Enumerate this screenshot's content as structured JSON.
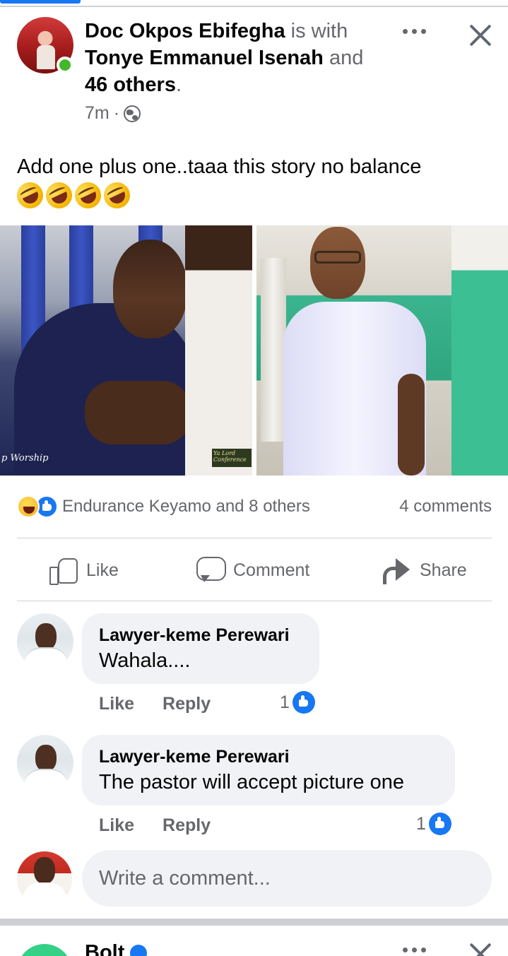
{
  "post": {
    "author": "Doc Okpos Ebifegha",
    "with_text": "is with",
    "tagged": "Tonye Emmanuel Isenah",
    "and_text": "and",
    "others": "46 others",
    "period": ".",
    "time": "7m",
    "separator": "·",
    "text": "Add one plus one..taaa this story no balance",
    "emojis": [
      "rofl-icon",
      "rofl-icon",
      "rofl-icon",
      "rofl-icon"
    ],
    "photo_caption": "p Worship",
    "photo_badge": "Ya Lord Conference"
  },
  "reactions": {
    "summary": "Endurance Keyamo and 8 others",
    "comments_count": "4 comments"
  },
  "actions": {
    "like": "Like",
    "comment": "Comment",
    "share": "Share"
  },
  "comments": [
    {
      "name": "Lawyer-keme Perewari",
      "text": "Wahala....",
      "like_label": "Like",
      "reply_label": "Reply",
      "likes": "1"
    },
    {
      "name": "Lawyer-keme Perewari",
      "text": "The pastor will accept picture one",
      "like_label": "Like",
      "reply_label": "Reply",
      "likes": "1"
    }
  ],
  "composer": {
    "placeholder": "Write a comment..."
  },
  "next_post": {
    "name": "Bolt"
  },
  "colors": {
    "brand_blue": "#1877f2",
    "text_secondary": "#65676b",
    "bubble_bg": "#f0f2f5",
    "online_green": "#42b72a"
  }
}
